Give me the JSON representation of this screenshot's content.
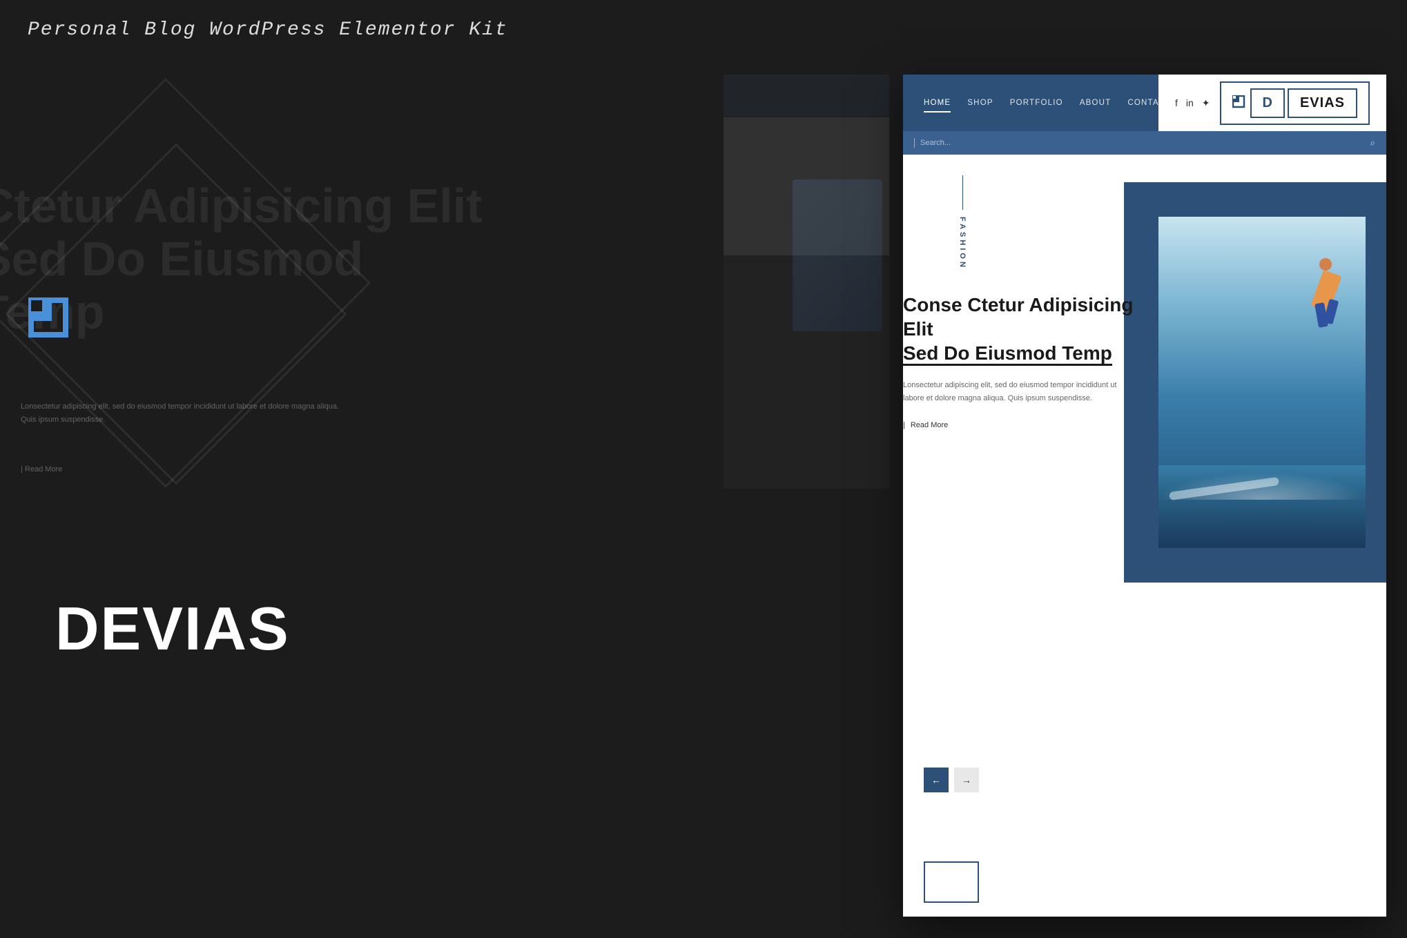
{
  "page": {
    "title": "Personal Blog WordPress Elementor Kit",
    "background_color": "#1c1c1c"
  },
  "brand": {
    "name": "DEVIAS",
    "logo_letter": "D",
    "logo_rest": "EVIAS"
  },
  "nav": {
    "items": [
      {
        "label": "HOME",
        "active": true
      },
      {
        "label": "SHOP",
        "active": false
      },
      {
        "label": "PORTFOLIO",
        "active": false
      },
      {
        "label": "ABOUT",
        "active": false
      },
      {
        "label": "CONTACT",
        "active": false
      }
    ],
    "search_placeholder": "Search...",
    "social": [
      "f",
      "in",
      "✦"
    ]
  },
  "hero": {
    "category_label": "FASHION",
    "title_line1": "Conse Ctetur Adipisicing Elit",
    "title_line2": "Sed Do Eiusmod Temp",
    "description": "Lonsectetur adipiscing elit, sed do eiusmod tempor incididunt ut labore et dolore magna aliqua. Quis ipsum suspendisse.",
    "read_more": "Read More",
    "arrow_left": "←",
    "arrow_right": "→"
  },
  "background_text": {
    "line1": "Ctetur Adipisicing Elit",
    "line2": "Sed Do Eiusmod",
    "line3": "Temp"
  }
}
